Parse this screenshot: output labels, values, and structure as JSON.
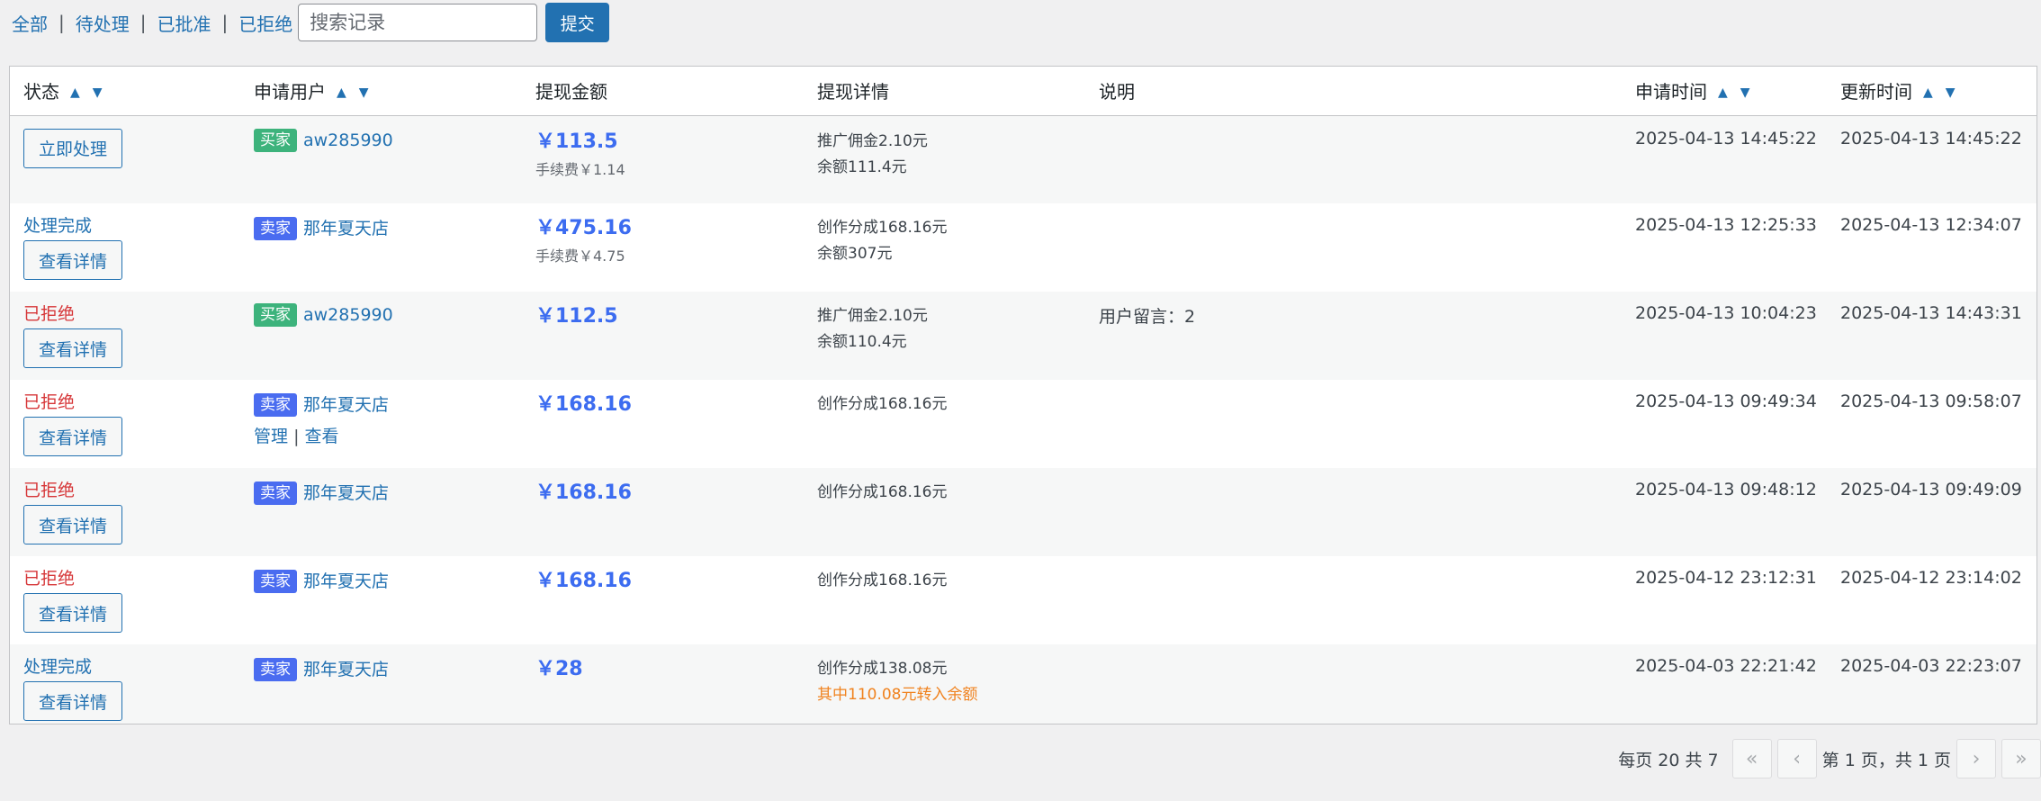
{
  "filters": {
    "all": "全部",
    "pending": "待处理",
    "approved": "已批准",
    "rejected": "已拒绝",
    "separator": "|"
  },
  "search": {
    "placeholder": "搜索记录",
    "submit_label": "提交"
  },
  "columns": {
    "status": "状态",
    "user": "申请用户",
    "amount": "提现金额",
    "detail": "提现详情",
    "note": "说明",
    "applied": "申请时间",
    "updated": "更新时间"
  },
  "sort_glyphs": "▲▼",
  "rows": [
    {
      "status": "",
      "button": "立即处理",
      "badge": "买家",
      "user": "aw285990",
      "amount": "￥113.5",
      "fee": "手续费￥1.14",
      "detail1": "推广佣金2.10元",
      "detail2": "余额111.4元",
      "note": "",
      "applied": "2025-04-13 14:45:22",
      "updated": "2025-04-13 14:45:22"
    },
    {
      "status": "处理完成",
      "button": "查看详情",
      "badge": "卖家",
      "user": "那年夏天店",
      "amount": "￥475.16",
      "fee": "手续费￥4.75",
      "detail1": "创作分成168.16元",
      "detail2": "余额307元",
      "note": "",
      "applied": "2025-04-13 12:25:33",
      "updated": "2025-04-13 12:34:07"
    },
    {
      "status": "已拒绝",
      "button": "查看详情",
      "badge": "买家",
      "user": "aw285990",
      "amount": "￥112.5",
      "fee": "",
      "detail1": "推广佣金2.10元",
      "detail2": "余额110.4元",
      "note": "用户留言：2",
      "applied": "2025-04-13 10:04:23",
      "updated": "2025-04-13 14:43:31"
    },
    {
      "status": "已拒绝",
      "button": "查看详情",
      "badge": "卖家",
      "user": "那年夏天店",
      "manage": "管理",
      "view": "查看",
      "amount": "￥168.16",
      "fee": "",
      "detail1": "创作分成168.16元",
      "detail2": "",
      "note": "",
      "applied": "2025-04-13 09:49:34",
      "updated": "2025-04-13 09:58:07"
    },
    {
      "status": "已拒绝",
      "button": "查看详情",
      "badge": "卖家",
      "user": "那年夏天店",
      "amount": "￥168.16",
      "fee": "",
      "detail1": "创作分成168.16元",
      "detail2": "",
      "note": "",
      "applied": "2025-04-13 09:48:12",
      "updated": "2025-04-13 09:49:09"
    },
    {
      "status": "已拒绝",
      "button": "查看详情",
      "badge": "卖家",
      "user": "那年夏天店",
      "amount": "￥168.16",
      "fee": "",
      "detail1": "创作分成168.16元",
      "detail2": "",
      "note": "",
      "applied": "2025-04-12 23:12:31",
      "updated": "2025-04-12 23:14:02"
    },
    {
      "status": "处理完成",
      "button": "查看详情",
      "badge": "卖家",
      "user": "那年夏天店",
      "amount": "￥28",
      "fee": "",
      "detail1": "创作分成138.08元",
      "detail2": "其中110.08元转入余额",
      "note": "",
      "applied": "2025-04-03 22:21:42",
      "updated": "2025-04-03 22:23:07"
    }
  ],
  "pagination": {
    "summary": "每页 20 共 7",
    "first": "«",
    "prev": "‹",
    "page_info": "第 1 页，共 1 页",
    "next": "›",
    "last": "»"
  },
  "colors": {
    "link": "#2271b1",
    "rejected": "#d63638",
    "amount": "#3c6cf0",
    "buyer_badge": "#3db37c",
    "seller_badge": "#4a6cf0",
    "orange_note": "#f0821e"
  }
}
